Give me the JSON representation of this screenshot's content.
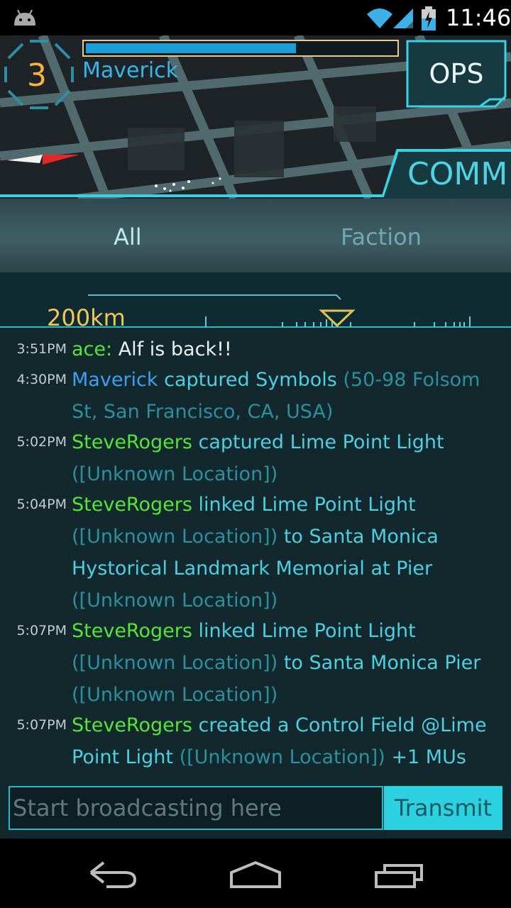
{
  "status_bar": {
    "time": "11:46",
    "icons": [
      "android-icon",
      "wifi-icon",
      "signal-icon",
      "battery-icon"
    ]
  },
  "player": {
    "level": "3",
    "name": "Maverick",
    "xp_fraction": 0.68
  },
  "ops_button": {
    "label": "OPS"
  },
  "comm_tab": {
    "label": "COMM"
  },
  "filters": {
    "all": "All",
    "faction": "Faction"
  },
  "range": {
    "label": "200km"
  },
  "messages": [
    {
      "time": "3:51PM",
      "who": "ace:",
      "who_color": "green",
      "text": "Alf is back!!",
      "text_style": "plain"
    },
    {
      "time": "4:30PM",
      "who": "Maverick",
      "who_color": "blue",
      "parts": [
        {
          "t": " captured Symbols ",
          "s": "action"
        },
        {
          "t": "(50-98 Folsom St, San Francisco, CA, USA)",
          "s": "loc"
        }
      ]
    },
    {
      "time": "5:02PM",
      "who": "SteveRogers",
      "who_color": "green",
      "parts": [
        {
          "t": " captured Lime Point Light ",
          "s": "action"
        },
        {
          "t": "([Unknown Location])",
          "s": "loc"
        }
      ]
    },
    {
      "time": "5:04PM",
      "who": "SteveRogers",
      "who_color": "green",
      "parts": [
        {
          "t": " linked Lime Point Light ",
          "s": "action"
        },
        {
          "t": "([Unknown Location])",
          "s": "loc"
        },
        {
          "t": " to Santa Monica Hystorical Landmark Memorial at Pier ",
          "s": "action"
        },
        {
          "t": "([Unknown Location])",
          "s": "loc"
        }
      ]
    },
    {
      "time": "5:07PM",
      "who": "SteveRogers",
      "who_color": "green",
      "parts": [
        {
          "t": " linked Lime Point Light ",
          "s": "action"
        },
        {
          "t": "([Unknown Location])",
          "s": "loc"
        },
        {
          "t": " to Santa Monica Pier ",
          "s": "action"
        },
        {
          "t": "([Unknown Location])",
          "s": "loc"
        }
      ]
    },
    {
      "time": "5:07PM",
      "who": "SteveRogers",
      "who_color": "green",
      "parts": [
        {
          "t": " created a Control Field @Lime Point Light ",
          "s": "action"
        },
        {
          "t": "([Unknown Location])",
          "s": "loc"
        },
        {
          "t": " +1 MUs",
          "s": "action"
        }
      ]
    }
  ],
  "composer": {
    "placeholder": "Start broadcasting here",
    "transmit_label": "Transmit"
  },
  "colors": {
    "accent": "#2bd0e1",
    "enlightened": "#55e43a",
    "resistance": "#3aa1f2",
    "level": "#f6b53a"
  },
  "nav": [
    "back-icon",
    "home-icon",
    "recents-icon"
  ]
}
